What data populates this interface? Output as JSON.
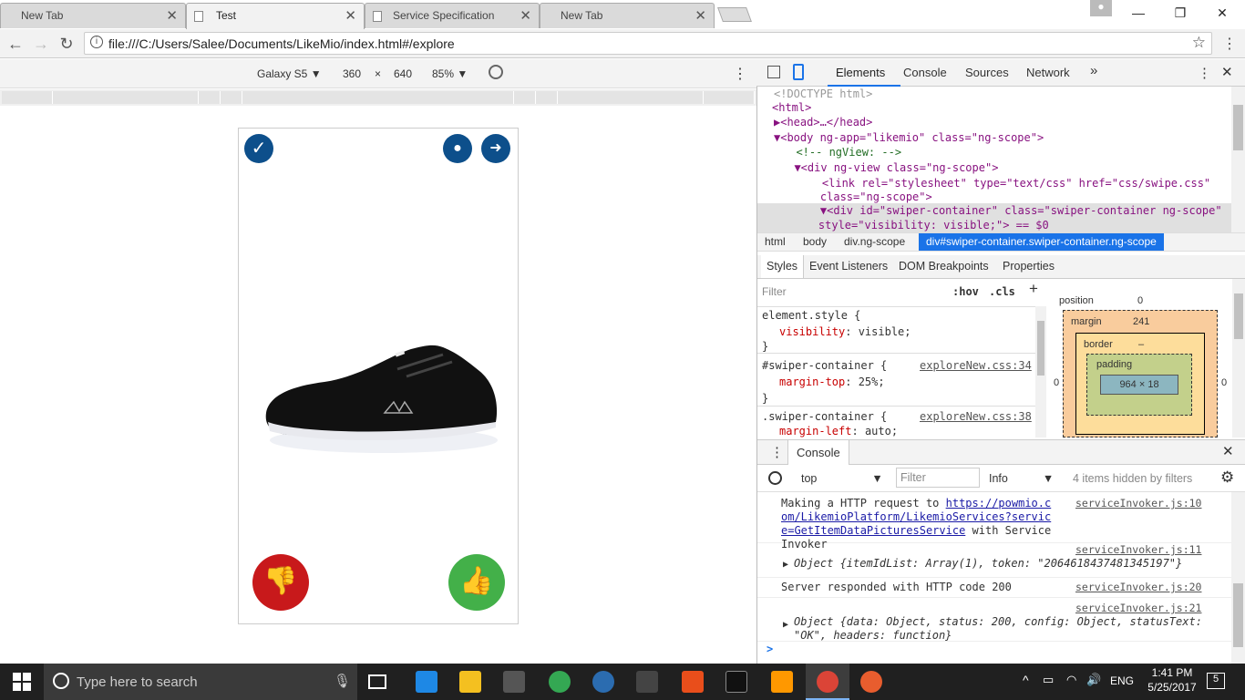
{
  "tabs": [
    {
      "label": "New Tab"
    },
    {
      "label": "Test"
    },
    {
      "label": "Service Specification"
    },
    {
      "label": "New Tab"
    }
  ],
  "address": {
    "url": "file:///C:/Users/Salee/Documents/LikeMio/index.html#/explore"
  },
  "device": {
    "name": "Galaxy S5",
    "width": "360",
    "times": "×",
    "height": "640",
    "zoom": "85%"
  },
  "devtools": {
    "tabs": [
      "Elements",
      "Console",
      "Sources",
      "Network"
    ],
    "more": "»",
    "dom": [
      "<!DOCTYPE html>",
      "<html>",
      "▶<head>…</head>",
      "▼<body ng-app=\"likemio\" class=\"ng-scope\">",
      "  <!-- ngView: -->",
      "  ▼<div ng-view class=\"ng-scope\">",
      "    <link rel=\"stylesheet\" type=\"text/css\" href=\"css/swipe.css\"",
      "    class=\"ng-scope\">",
      "    ▼<div id=\"swiper-container\" class=\"swiper-container ng-scope\"",
      "    style=\"visibility: visible;\"> == $0"
    ],
    "breadcrumbs": [
      "html",
      "body",
      "div.ng-scope",
      "div#swiper-container.swiper-container.ng-scope"
    ],
    "subtabs": [
      "Styles",
      "Event Listeners",
      "DOM Breakpoints",
      "Properties"
    ],
    "styles_filter": "Filter",
    "hov": ":hov",
    "cls": ".cls",
    "rules": [
      {
        "selector": "element.style {",
        "prop": "visibility",
        "value": "visible;",
        "src": ""
      },
      {
        "selector": "#swiper-container {",
        "prop": "margin-top",
        "value": "25%;",
        "src": "exploreNew.css:34"
      },
      {
        "selector": ".swiper-container {",
        "prop": "margin-left",
        "value": "auto;",
        "src": "exploreNew.css:38"
      }
    ],
    "boxmodel": {
      "position_label": "position",
      "position_value": "0",
      "margin_label": "margin",
      "margin_value": "241",
      "border_label": "border",
      "padding_label": "padding",
      "content": "964 × 18",
      "dash": "–",
      "zero": "0"
    },
    "console": {
      "title": "Console",
      "context": "top",
      "filter_placeholder": "Filter",
      "level": "Info",
      "hidden": "4 items hidden by filters",
      "entries": [
        {
          "text": "Making a HTTP request to ",
          "link": "https://powmio.com/LikemioPlatform/LikemioServices?service=GetItemDataPicturesService",
          "after": " with ServiceInvoker",
          "src": "serviceInvoker.js:10"
        },
        {
          "text": "Object {itemIdList: Array(1), token: \"2064618437481345197\"}",
          "src": "serviceInvoker.js:11"
        },
        {
          "text": "Server responded with HTTP code 200",
          "src": "serviceInvoker.js:20"
        },
        {
          "text": "Object {data: Object, status: 200, config: Object, statusText: \"OK\", headers: function}",
          "src": "serviceInvoker.js:21"
        }
      ],
      "prompt": ">"
    }
  },
  "taskbar": {
    "search_placeholder": "Type here to search",
    "lang": "ENG",
    "time": "1:41 PM",
    "date": "5/25/2017",
    "notifications": "5"
  },
  "colors": {
    "brand_blue": "#0d4f8b",
    "dislike_red": "#c8191b",
    "like_green": "#43b049"
  }
}
